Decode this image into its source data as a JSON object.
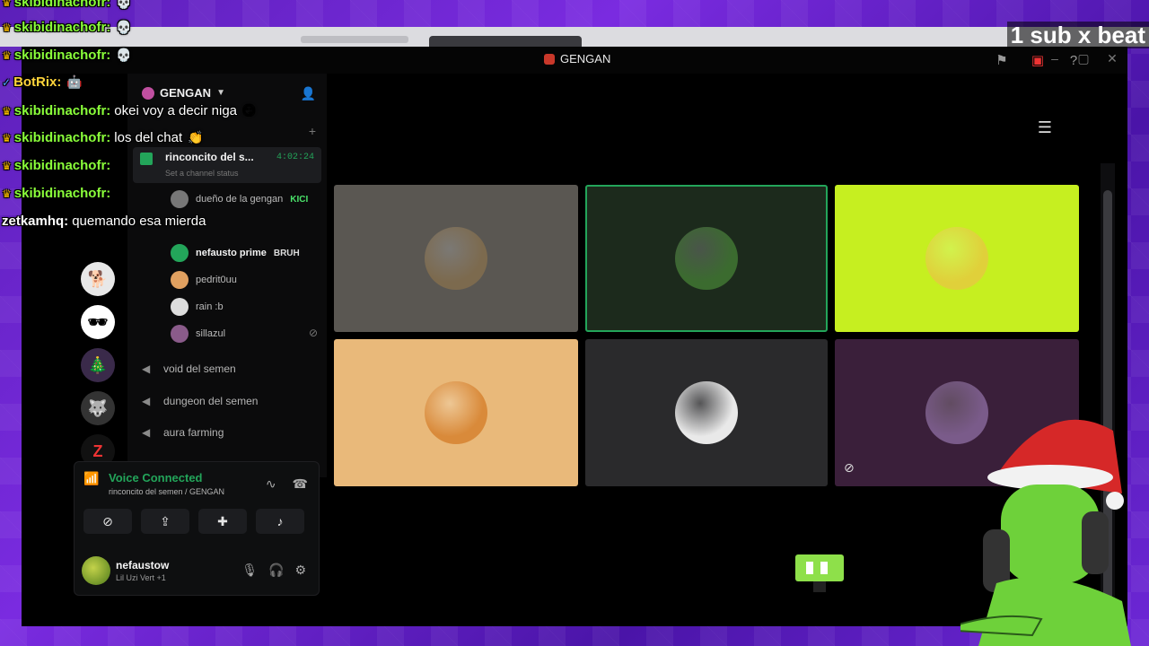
{
  "overlay": {
    "tag": "1 sub x beat",
    "chat": [
      {
        "user": "skibidinachofr:",
        "message": "",
        "emoji": "💀",
        "badge": "crown"
      },
      {
        "user": "skibidinachofr:",
        "message": "",
        "emoji": "💀",
        "badge": "crown"
      },
      {
        "user": "skibidinachofr:",
        "message": "",
        "emoji": "💀",
        "badge": "crown"
      },
      {
        "user": "BotRix:",
        "message": "",
        "emoji": "🤖",
        "badge": "bot"
      },
      {
        "user": "skibidinachofr:",
        "message": "okei voy a decir niga",
        "emoji": "😏",
        "badge": "crown"
      },
      {
        "user": "skibidinachofr:",
        "message": "los del chat",
        "emoji": "👏",
        "badge": "crown"
      },
      {
        "user": "skibidinachofr:",
        "message": "",
        "emoji": "",
        "badge": "crown"
      },
      {
        "user": "skibidinachofr:",
        "message": "",
        "emoji": "",
        "badge": "crown"
      },
      {
        "user": "zetkamhq:",
        "message": "quemando esa mierda",
        "emoji": "",
        "badge": "none"
      }
    ]
  },
  "titlebar": {
    "server_name": "GENGAN",
    "icons": [
      "inbox-icon",
      "screen-icon",
      "help-icon"
    ],
    "window_controls": [
      "–",
      "▢",
      "✕"
    ]
  },
  "guild": {
    "name": "GENGAN",
    "active_voice": {
      "name": "rinconcito del s...",
      "time": "4:02:24",
      "status": "Set a channel status"
    },
    "members": [
      {
        "name": "dueño de la gengan",
        "tag": "KICI",
        "bold": false
      },
      {
        "name": "nefausto prime",
        "tag": "BRUH",
        "bold": true
      },
      {
        "name": "pedrit0uu",
        "tag": "",
        "bold": false
      },
      {
        "name": "rain :b",
        "tag": "",
        "bold": false
      },
      {
        "name": "sillazul",
        "tag": "",
        "bold": false
      }
    ],
    "voice_channels": [
      "void del semen",
      "dungeon del semen",
      "aura farming"
    ]
  },
  "voice_panel": {
    "title": "Voice Connected",
    "subtitle": "rinconcito del semen / GENGAN"
  },
  "account": {
    "username": "nefaustow",
    "activity": "Lil Uzi Vert +1"
  },
  "stage": {
    "tiles": [
      {
        "name": "otter-tile",
        "bg": "#5a5752",
        "avatar": "#7c6a4e",
        "speaking": false
      },
      {
        "name": "green-tile",
        "bg": "#1c2a1c",
        "avatar": "#3b6b2f",
        "speaking": true
      },
      {
        "name": "yellow-tile",
        "bg": "#c6ef20",
        "avatar": "#e0d03a",
        "speaking": false
      },
      {
        "name": "sunset-tile",
        "bg": "#e9b97a",
        "avatar": "#d98a3a",
        "speaking": false
      },
      {
        "name": "masked-tile",
        "bg": "#2a2a2c",
        "avatar": "#e9e9e9",
        "speaking": false
      },
      {
        "name": "purple-tile",
        "bg": "#3a1f3a",
        "avatar": "#7a5b8a",
        "speaking": false
      }
    ]
  },
  "colors": {
    "accent_green": "#23a55a",
    "chat_user": "#8aff3a",
    "background_purple": "#5b1fb8"
  }
}
